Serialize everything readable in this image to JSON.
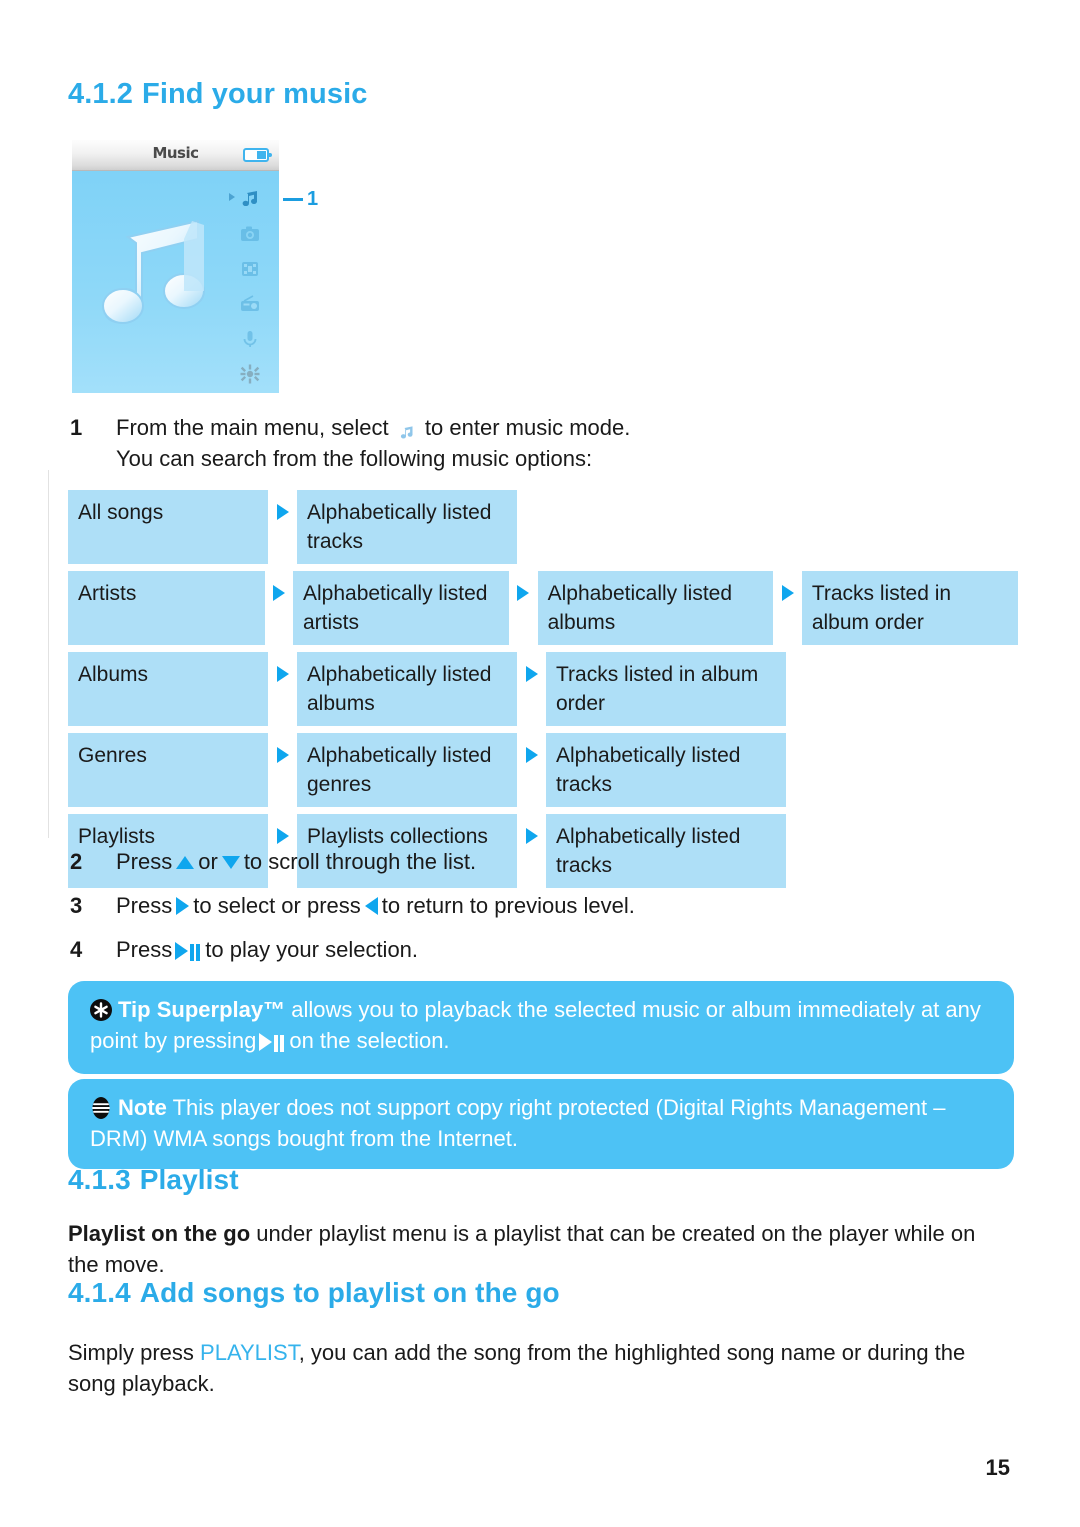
{
  "document": {
    "page_number": "15"
  },
  "headings": {
    "find_music": {
      "number": "4.1.2",
      "title": "Find your music"
    },
    "playlist": {
      "number": "4.1.3",
      "title": "Playlist"
    },
    "add_songs": {
      "number": "4.1.4",
      "title": "Add songs to playlist on the go"
    }
  },
  "device": {
    "title": "Music",
    "battery_icon": "battery-icon",
    "main_icon": "music-note-icon",
    "callout_label": "1",
    "menu_icons": [
      {
        "name": "music-note-icon",
        "selected": true
      },
      {
        "name": "camera-icon",
        "selected": false
      },
      {
        "name": "video-icon",
        "selected": false
      },
      {
        "name": "radio-icon",
        "selected": false
      },
      {
        "name": "voice-recorder-icon",
        "selected": false
      },
      {
        "name": "settings-gear-icon",
        "selected": false
      }
    ]
  },
  "steps": [
    {
      "number": "1",
      "line1_before": "From the main menu, select",
      "line1_after": "to enter music mode.",
      "line2": "You can search from the following music options:"
    },
    {
      "number": "2",
      "before": "Press",
      "middle": "or",
      "after": "to scroll through the list."
    },
    {
      "number": "3",
      "before": "Press",
      "middle": "to select or press",
      "after": "to return to previous level."
    },
    {
      "number": "4",
      "before": "Press",
      "after": "to play your selection."
    }
  ],
  "flow_table": {
    "rows": [
      {
        "cells": [
          "All songs",
          "Alphabetically listed tracks"
        ]
      },
      {
        "cells": [
          "Artists",
          "Alphabetically listed artists",
          "Alphabetically listed albums",
          "Tracks listed in album order"
        ]
      },
      {
        "cells": [
          "Albums",
          "Alphabetically listed albums",
          "Tracks listed in album order"
        ]
      },
      {
        "cells": [
          "Genres",
          "Alphabetically listed genres",
          "Alphabetically listed tracks"
        ]
      },
      {
        "cells": [
          "Playlists",
          "Playlists collections",
          "Alphabetically listed tracks"
        ]
      }
    ]
  },
  "tip_box": {
    "icon": "asterisk-badge-icon",
    "label": "Tip",
    "product": "Superplay™",
    "text_before": "allows you to playback the selected music or album immediately at any point by pressing",
    "text_after": "on the selection."
  },
  "note_box": {
    "icon": "note-badge-icon",
    "label": "Note",
    "text": "This player does not support copy right protected (Digital Rights Management – DRM) WMA songs bought from the Internet."
  },
  "playlist_para": {
    "bold": "Playlist on the go",
    "text": "under playlist menu is a playlist that can be created on the player while on the move."
  },
  "add_songs_para": {
    "before": "Simply press",
    "keyword": "PLAYLIST",
    "after": ", you can add the song from the highlighted song name or during the song playback."
  },
  "colors": {
    "heading_blue": "#2BABE8",
    "cell_blue": "#AEDFF7",
    "box_blue": "#4DC2F5",
    "arrow_blue": "#0FA6EE",
    "keyword_blue": "#35B3EC"
  }
}
